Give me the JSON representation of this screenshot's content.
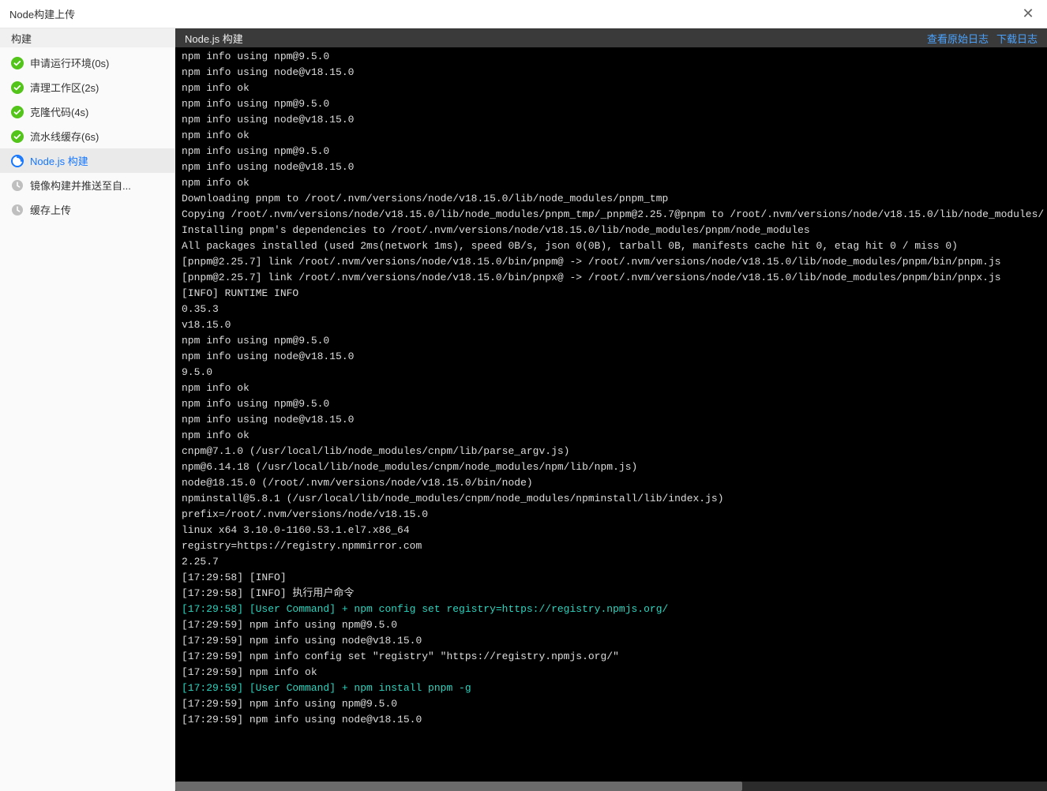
{
  "window": {
    "title": "Node构建上传"
  },
  "sidebar": {
    "header": "构建",
    "items": [
      {
        "label": "申请运行环境(0s)",
        "status": "success"
      },
      {
        "label": "清理工作区(2s)",
        "status": "success"
      },
      {
        "label": "克隆代码(4s)",
        "status": "success"
      },
      {
        "label": "流水线缓存(6s)",
        "status": "success"
      },
      {
        "label": "Node.js 构建",
        "status": "running",
        "active": true
      },
      {
        "label": "镜像构建并推送至自...",
        "status": "pending"
      },
      {
        "label": "缓存上传",
        "status": "pending"
      }
    ]
  },
  "main": {
    "title": "Node.js 构建",
    "links": {
      "raw": "查看原始日志",
      "download": "下载日志"
    }
  },
  "log": [
    {
      "t": "npm info using npm@9.5.0"
    },
    {
      "t": "npm info using node@v18.15.0"
    },
    {
      "t": "npm info ok"
    },
    {
      "t": "npm info using npm@9.5.0"
    },
    {
      "t": "npm info using node@v18.15.0"
    },
    {
      "t": "npm info ok"
    },
    {
      "t": "npm info using npm@9.5.0"
    },
    {
      "t": "npm info using node@v18.15.0"
    },
    {
      "t": "npm info ok"
    },
    {
      "t": "Downloading pnpm to /root/.nvm/versions/node/v18.15.0/lib/node_modules/pnpm_tmp"
    },
    {
      "t": "Copying /root/.nvm/versions/node/v18.15.0/lib/node_modules/pnpm_tmp/_pnpm@2.25.7@pnpm to /root/.nvm/versions/node/v18.15.0/lib/node_modules/"
    },
    {
      "t": "Installing pnpm's dependencies to /root/.nvm/versions/node/v18.15.0/lib/node_modules/pnpm/node_modules"
    },
    {
      "t": "All packages installed (used 2ms(network 1ms), speed 0B/s, json 0(0B), tarball 0B, manifests cache hit 0, etag hit 0 / miss 0)"
    },
    {
      "t": "[pnpm@2.25.7] link /root/.nvm/versions/node/v18.15.0/bin/pnpm@ -> /root/.nvm/versions/node/v18.15.0/lib/node_modules/pnpm/bin/pnpm.js"
    },
    {
      "t": "[pnpm@2.25.7] link /root/.nvm/versions/node/v18.15.0/bin/pnpx@ -> /root/.nvm/versions/node/v18.15.0/lib/node_modules/pnpm/bin/pnpx.js"
    },
    {
      "t": "[INFO] RUNTIME INFO"
    },
    {
      "t": "0.35.3"
    },
    {
      "t": "v18.15.0"
    },
    {
      "t": "npm info using npm@9.5.0"
    },
    {
      "t": "npm info using node@v18.15.0"
    },
    {
      "t": "9.5.0"
    },
    {
      "t": "npm info ok"
    },
    {
      "t": "npm info using npm@9.5.0"
    },
    {
      "t": "npm info using node@v18.15.0"
    },
    {
      "t": "npm info ok"
    },
    {
      "t": "cnpm@7.1.0 (/usr/local/lib/node_modules/cnpm/lib/parse_argv.js)"
    },
    {
      "t": "npm@6.14.18 (/usr/local/lib/node_modules/cnpm/node_modules/npm/lib/npm.js)"
    },
    {
      "t": "node@18.15.0 (/root/.nvm/versions/node/v18.15.0/bin/node)"
    },
    {
      "t": "npminstall@5.8.1 (/usr/local/lib/node_modules/cnpm/node_modules/npminstall/lib/index.js)"
    },
    {
      "t": "prefix=/root/.nvm/versions/node/v18.15.0"
    },
    {
      "t": "linux x64 3.10.0-1160.53.1.el7.x86_64"
    },
    {
      "t": "registry=https://registry.npmmirror.com"
    },
    {
      "t": "2.25.7"
    },
    {
      "t": "[17:29:58] [INFO]"
    },
    {
      "t": "[17:29:58] [INFO] 执行用户命令"
    },
    {
      "t": "[17:29:58] [User Command] + npm config set registry=https://registry.npmjs.org/",
      "c": "cyan"
    },
    {
      "t": "[17:29:59] npm info using npm@9.5.0"
    },
    {
      "t": "[17:29:59] npm info using node@v18.15.0"
    },
    {
      "t": "[17:29:59] npm info config set \"registry\" \"https://registry.npmjs.org/\""
    },
    {
      "t": "[17:29:59] npm info ok"
    },
    {
      "t": "[17:29:59] [User Command] + npm install pnpm -g",
      "c": "cyan"
    },
    {
      "t": "[17:29:59] npm info using npm@9.5.0"
    },
    {
      "t": "[17:29:59] npm info using node@v18.15.0"
    }
  ]
}
